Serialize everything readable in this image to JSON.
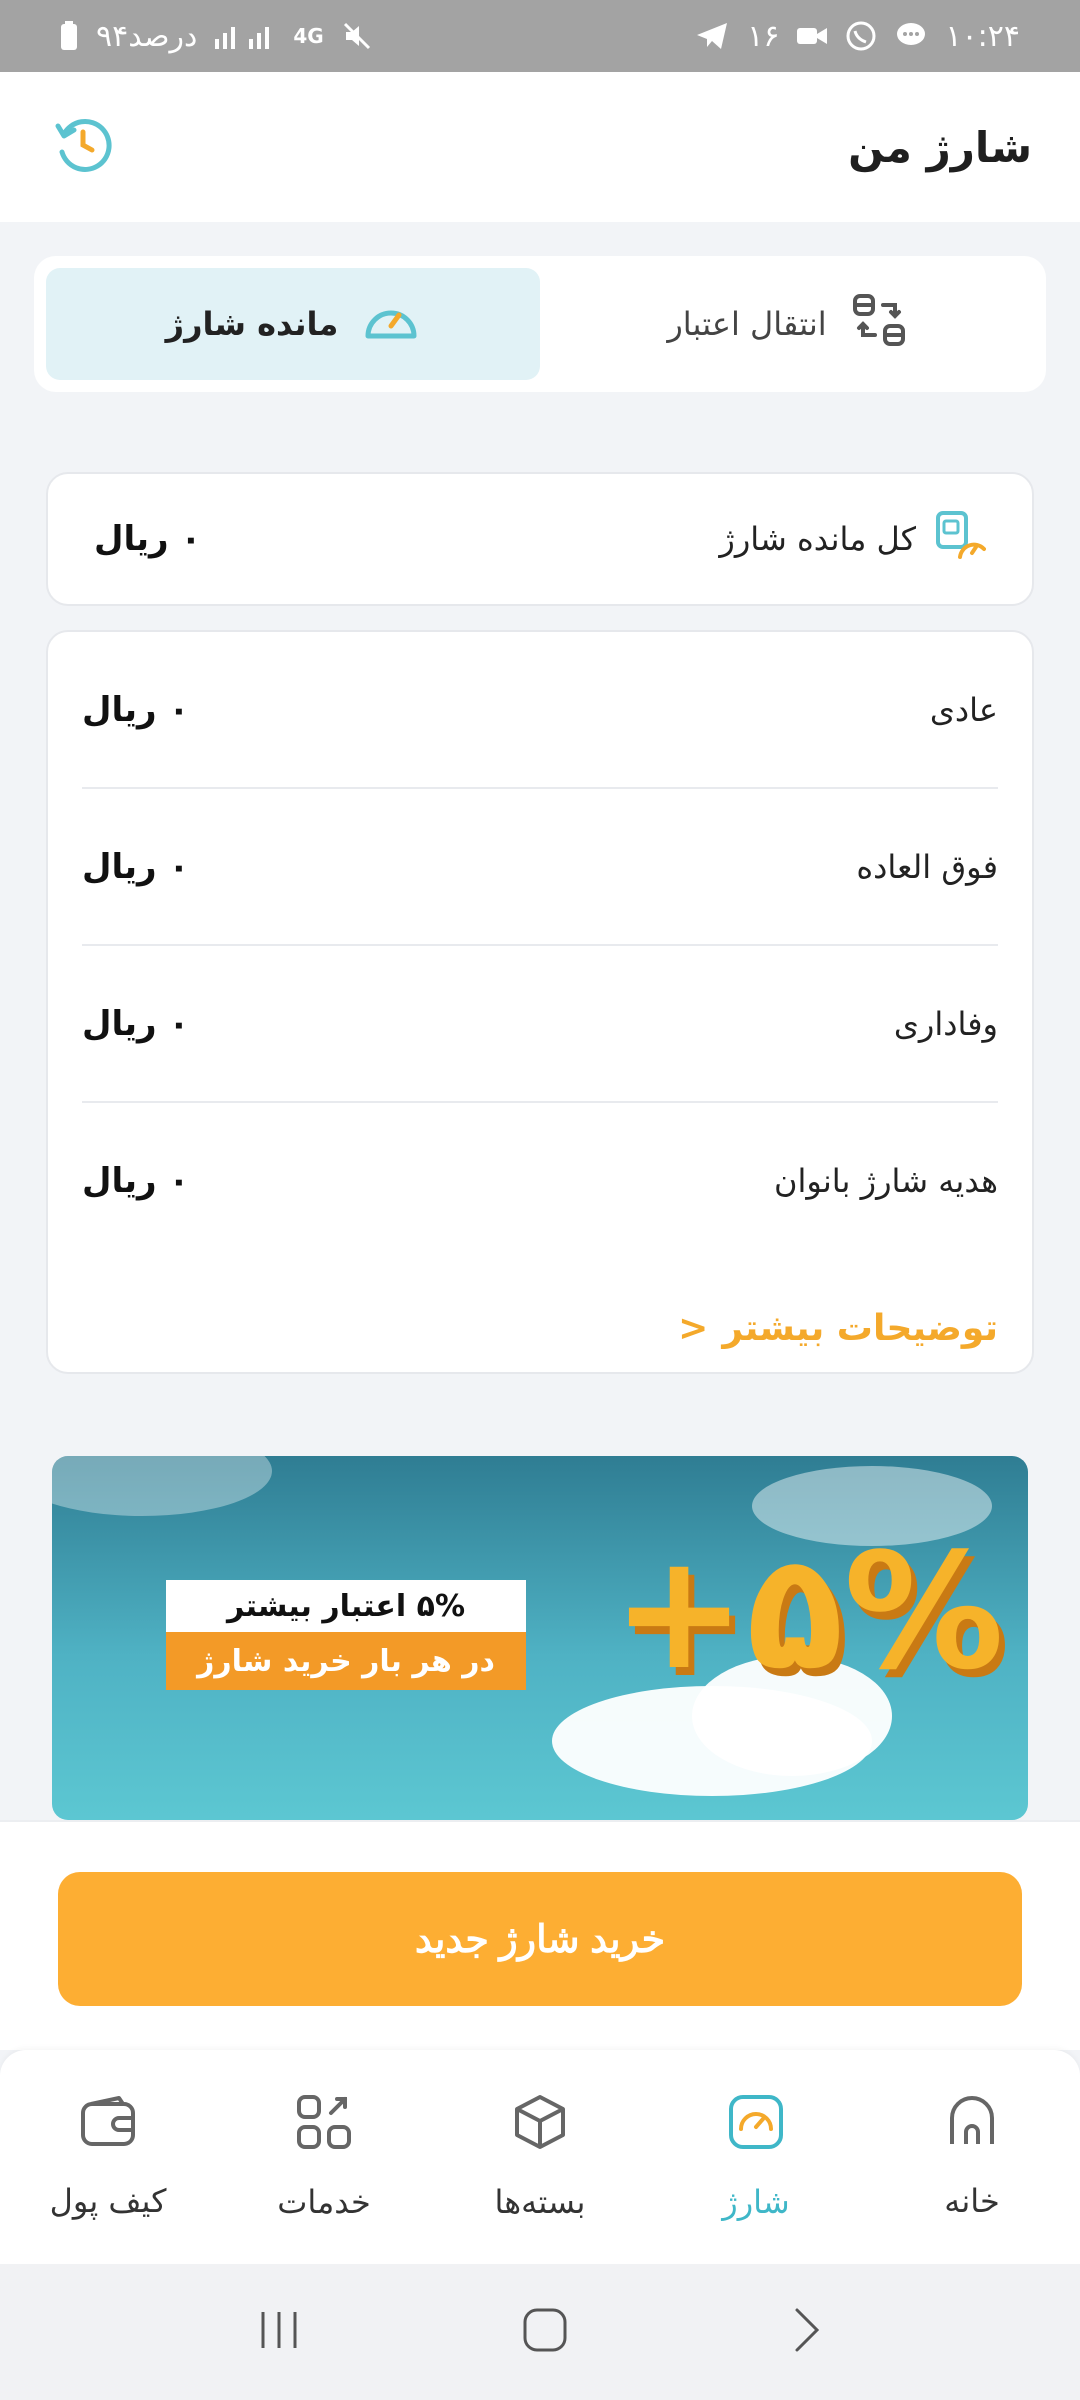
{
  "status_bar": {
    "time": "۱۰:۲۴",
    "notification_count": "۱۶",
    "battery_text": "۹۴درصد",
    "network": "4G"
  },
  "header": {
    "title": "شارژ من",
    "history_icon": "history-icon"
  },
  "tabs": [
    {
      "label": "مانده شارژ",
      "icon": "gauge-icon",
      "active": true
    },
    {
      "label": "انتقال اعتبار",
      "icon": "transfer-icon",
      "active": false
    }
  ],
  "total": {
    "label": "کل مانده شارژ",
    "amount": "۰ ریال"
  },
  "details": {
    "rows": [
      {
        "label": "عادی",
        "amount": "۰ ریال"
      },
      {
        "label": "فوق العاده",
        "amount": "۰ ریال"
      },
      {
        "label": "وفاداری",
        "amount": "۰ ریال"
      },
      {
        "label": "هدیه شارژ بانوان",
        "amount": "۰ ریال"
      }
    ],
    "more_link": "توضیحات بیشتر",
    "more_arrow": ">"
  },
  "banner": {
    "line1": "۵% اعتبار بیشتر",
    "line2": "در هر بار خرید شارژ",
    "big_text": "+۵%"
  },
  "buy_button": "خرید شارژ جدید",
  "bottom_nav": [
    {
      "label": "خانه",
      "icon": "home-icon",
      "active": false
    },
    {
      "label": "شارژ",
      "icon": "charge-gauge-icon",
      "active": true
    },
    {
      "label": "بسته‌ها",
      "icon": "package-icon",
      "active": false
    },
    {
      "label": "خدمات",
      "icon": "services-grid-icon",
      "active": false
    },
    {
      "label": "کیف پول",
      "icon": "wallet-icon",
      "active": false
    }
  ],
  "colors": {
    "accent": "#fdae33",
    "teal": "#3fb7c8",
    "tab_active_bg": "#e1f2f6"
  }
}
